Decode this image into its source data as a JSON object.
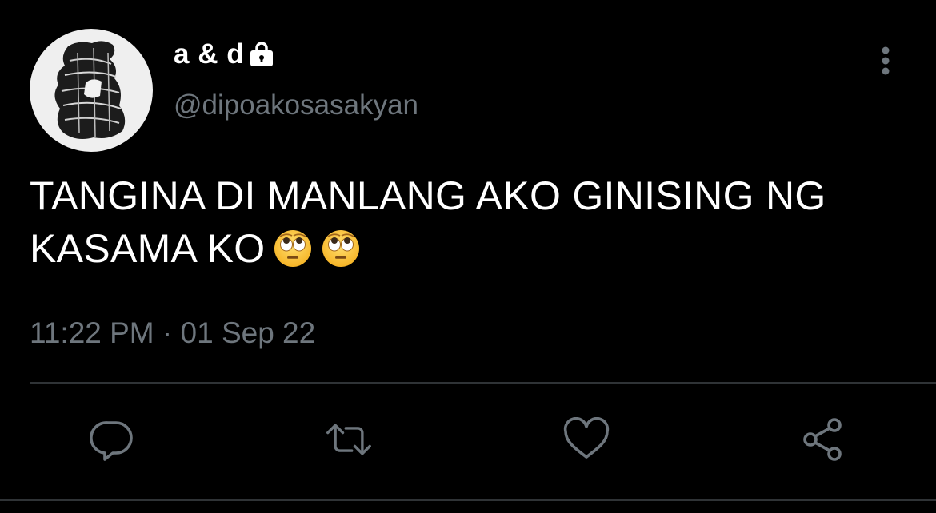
{
  "user": {
    "display_name": "a & d",
    "handle": "@dipoakosasakyan",
    "protected_icon": "lock-icon",
    "avatar_icon": "avatar-image"
  },
  "tweet": {
    "text_line1": "TANGINA DI MANLANG AKO GINISING NG",
    "text_line2": "KASAMA KO",
    "emojis": [
      "face-with-rolling-eyes",
      "face-with-rolling-eyes"
    ],
    "timestamp": "11:22 PM · 01 Sep 22"
  },
  "actions": [
    {
      "icon": "reply-icon"
    },
    {
      "icon": "retweet-icon"
    },
    {
      "icon": "like-icon"
    },
    {
      "icon": "share-icon"
    }
  ],
  "colors": {
    "background": "#000000",
    "text_primary": "#ffffff",
    "text_secondary": "#6e767d",
    "divider": "#2f3336"
  }
}
